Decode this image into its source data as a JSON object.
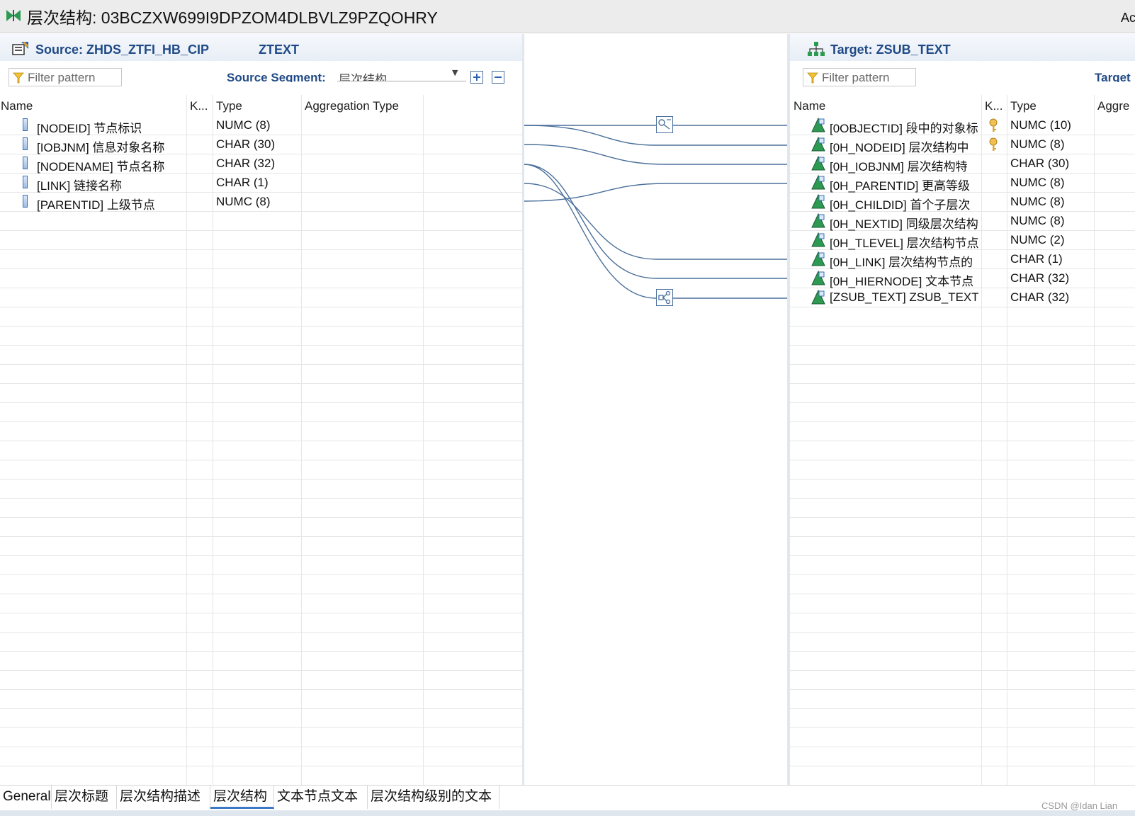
{
  "window": {
    "title": "层次结构: 03BCZXW699I9DPZOM4DLBVLZ9PZQOHRY",
    "title_right": "Ac"
  },
  "source": {
    "title": "Source: ZHDS_ZTFI_HB_CIP",
    "subtitle": "ZTEXT",
    "filter_placeholder": "Filter pattern",
    "segment_label": "Source Segment:",
    "segment_value": "层次结构",
    "columns": {
      "name": "Name",
      "key": "K...",
      "type": "Type",
      "agg": "Aggregation Type"
    },
    "rows": [
      {
        "name": "[NODEID] 节点标识",
        "type": "NUMC (8)"
      },
      {
        "name": "[IOBJNM] 信息对象名称",
        "type": "CHAR (30)"
      },
      {
        "name": "[NODENAME] 节点名称",
        "type": "CHAR (32)"
      },
      {
        "name": "[LINK] 链接名称",
        "type": "CHAR (1)"
      },
      {
        "name": "[PARENTID] 上级节点",
        "type": "NUMC (8)"
      }
    ]
  },
  "target": {
    "title": "Target: ZSUB_TEXT",
    "filter_placeholder": "Filter pattern",
    "segment_label": "Target",
    "columns": {
      "name": "Name",
      "key": "K...",
      "type": "Type",
      "agg": "Aggre"
    },
    "rows": [
      {
        "name": "[0OBJECTID] 段中的对象标",
        "type": "NUMC (10)",
        "key": true
      },
      {
        "name": "[0H_NODEID] 层次结构中",
        "type": "NUMC (8)",
        "key": true
      },
      {
        "name": "[0H_IOBJNM] 层次结构特",
        "type": "CHAR (30)",
        "key": false
      },
      {
        "name": "[0H_PARENTID] 更高等级",
        "type": "NUMC (8)",
        "key": false
      },
      {
        "name": "[0H_CHILDID] 首个子层次",
        "type": "NUMC (8)",
        "key": false
      },
      {
        "name": "[0H_NEXTID] 同级层次结构",
        "type": "NUMC (8)",
        "key": false
      },
      {
        "name": "[0H_TLEVEL] 层次结构节点",
        "type": "NUMC (2)",
        "key": false
      },
      {
        "name": "[0H_LINK] 层次结构节点的",
        "type": "CHAR (1)",
        "key": false
      },
      {
        "name": "[0H_HIERNODE] 文本节点",
        "type": "CHAR (32)",
        "key": false
      },
      {
        "name": "[ZSUB_TEXT] ZSUB_TEXT",
        "type": "CHAR (32)",
        "key": false
      }
    ]
  },
  "tabs": [
    "General",
    "层次标题",
    "层次结构描述",
    "层次结构",
    "文本节点文本",
    "层次结构级别的文本"
  ],
  "active_tab": "层次结构",
  "watermark": "CSDN @Idan Lian",
  "colors": {
    "header_text": "#1f4a86",
    "link_line": "#4a6f9a",
    "active_tab": "#3a78c8"
  }
}
